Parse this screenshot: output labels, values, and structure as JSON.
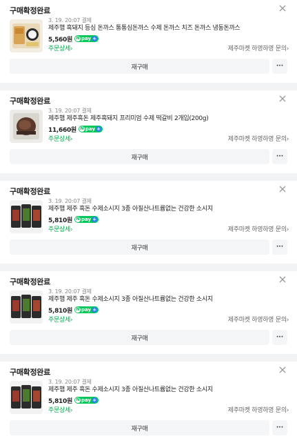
{
  "colors": {
    "background": "#f2f3f5",
    "card": "#ffffff",
    "naver_green": "#03c75a",
    "link_green": "#03a94e",
    "button_bg": "#f4f5f7"
  },
  "orders": [
    {
      "status": "구매확정완료",
      "date": "3. 19. 20:07 결제",
      "title": "제주햄 흑돼지 등심 돈까스 통통심돈까스 수제 돈까스 치즈 돈까스 냉동돈까스",
      "price": "5,560원",
      "pay_label": "pay",
      "order_detail": "주문상세",
      "seller": "제주마켓 하영하영 문의",
      "rebuy": "재구매",
      "more": "···",
      "thumb_icon": "tonkatsu-product-image"
    },
    {
      "status": "구매확정완료",
      "date": "3. 19. 20:07 결제",
      "title": "제주햄 제주흑돈 제주흑돼지 프리미엄 수제 떡갈비 2개입(200g)",
      "price": "11,660원",
      "pay_label": "pay",
      "order_detail": "주문상세",
      "seller": "제주마켓 하영하영 문의",
      "rebuy": "재구매",
      "more": "···",
      "thumb_icon": "tteokgalbi-product-image"
    },
    {
      "status": "구매확정완료",
      "date": "3. 19. 20:07 결제",
      "title": "제주햄 제주 흑돈 수제소시지 3종 아질산나트륨없는 건강한 소시지",
      "price": "5,810원",
      "pay_label": "pay",
      "order_detail": "주문상세",
      "seller": "제주마켓 하영하영 문의",
      "rebuy": "재구매",
      "more": "···",
      "thumb_icon": "sausage-product-image"
    },
    {
      "status": "구매확정완료",
      "date": "3. 19. 20:07 결제",
      "title": "제주햄 제주 흑돈 수제소시지 3종 아질산나트륨없는 건강한 소시지",
      "price": "5,810원",
      "pay_label": "pay",
      "order_detail": "주문상세",
      "seller": "제주마켓 하영하영 문의",
      "rebuy": "재구매",
      "more": "···",
      "thumb_icon": "sausage-product-image"
    },
    {
      "status": "구매확정완료",
      "date": "3. 19. 20:07 결제",
      "title": "제주햄 제주 흑돈 수제소시지 3종 아질산나트륨없는 건강한 소시지",
      "price": "5,810원",
      "pay_label": "pay",
      "order_detail": "주문상세",
      "seller": "제주마켓 하영하영 문의",
      "rebuy": "재구매",
      "more": "···",
      "thumb_icon": "sausage-product-image"
    }
  ]
}
